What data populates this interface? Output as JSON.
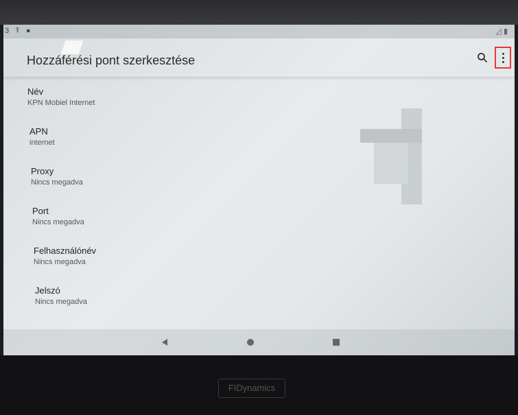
{
  "status_bar": {
    "time_fragment": "3",
    "right_icons": "◿ ▮"
  },
  "app_bar": {
    "title": "Hozzáférési pont szerkesztése"
  },
  "icons": {
    "search": "search-icon",
    "more": "more-vert-icon"
  },
  "preferences": [
    {
      "title": "Név",
      "summary": "KPN Mobiel Internet"
    },
    {
      "title": "APN",
      "summary": "internet"
    },
    {
      "title": "Proxy",
      "summary": "Nincs megadva"
    },
    {
      "title": "Port",
      "summary": "Nincs megadva"
    },
    {
      "title": "Felhasználónév",
      "summary": "Nincs megadva"
    },
    {
      "title": "Jelszó",
      "summary": "Nincs megadva"
    }
  ],
  "device": {
    "brand": "FIDynamics"
  },
  "colors": {
    "highlight": "#e53935"
  }
}
